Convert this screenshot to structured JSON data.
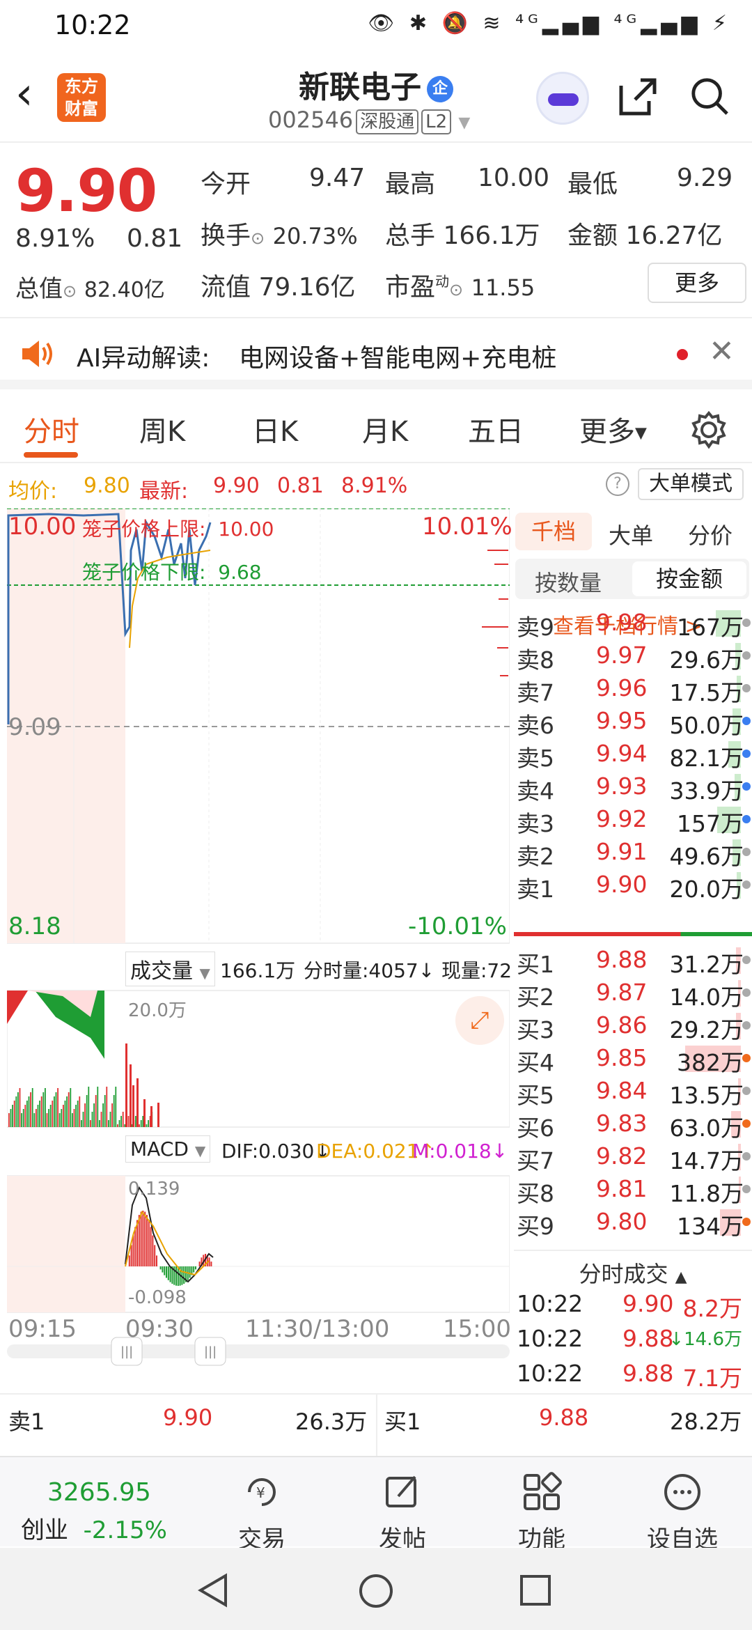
{
  "status": {
    "time": "10:22",
    "icons": "👁 ✱ 🔕 ≋ ⁴ᴳ▂▄▆ ⁴ᴳ▂▄▆ ⚡"
  },
  "header": {
    "title": "新联电子",
    "badge": "企",
    "code": "002546",
    "tag1": "深股通",
    "tag2": "L2",
    "logo_l1": "东方",
    "logo_l2": "财富"
  },
  "quote": {
    "price": "9.90",
    "pct": "8.91%",
    "chg": "0.81",
    "open_l": "今开",
    "open_v": "9.47",
    "high_l": "最高",
    "high_v": "10.00",
    "low_l": "最低",
    "low_v": "9.29",
    "turn_l": "换手",
    "turn_v": "20.73%",
    "vol_l": "总手",
    "vol_v": "166.1万",
    "amt_l": "金额",
    "amt_v": "16.27亿",
    "cap_l": "总值",
    "cap_v": "82.40亿",
    "flt_l": "流值",
    "flt_v": "79.16亿",
    "pe_l": "市盈",
    "pe_sup": "动",
    "pe_v": "11.55",
    "more": "更多"
  },
  "ai_banner": {
    "label": "AI异动解读:",
    "text": "电网设备+智能电网+充电桩"
  },
  "tabs": [
    "分时",
    "周K",
    "日K",
    "月K",
    "五日",
    "更多"
  ],
  "info": {
    "avg_l": "均价:",
    "avg_v": "9.80",
    "last_l": "最新:",
    "last_v": "9.90",
    "chg": "0.81",
    "pct": "8.91%",
    "mode": "大单模式"
  },
  "chart": {
    "top_price": "10.00",
    "top_pct": "10.01%",
    "mid_price": "9.09",
    "bot_price": "8.18",
    "bot_pct": "-10.01%",
    "cage_up_l": "笼子价格上限:",
    "cage_up_v": "10.00",
    "cage_dn_l": "笼子价格下限:",
    "cage_dn_v": "9.68",
    "vol_sel": "成交量",
    "vol_total": "166.1万",
    "vol_min_l": "分时量:4057↓",
    "vol_now": "现量:72",
    "vol_scale": "20.0万",
    "macd_sel": "MACD",
    "dif": "DIF:0.030↓",
    "dea": "DEA:0.021↑",
    "m": "M:0.018↓",
    "macd_top": "0.139",
    "macd_bot": "-0.098",
    "times": [
      "09:15",
      "09:30",
      "11:30/13:00",
      "15:00"
    ]
  },
  "orderbook": {
    "tabs": [
      "千档",
      "大单",
      "分价"
    ],
    "sub": [
      "按数量",
      "按金额"
    ],
    "link": "查看千档行情 >",
    "asks": [
      {
        "l": "卖9",
        "p": "9.98",
        "v": "167万",
        "bar": 36,
        "dot": "#aaa"
      },
      {
        "l": "卖8",
        "p": "9.97",
        "v": "29.6万",
        "bar": 8,
        "dot": "#aaa"
      },
      {
        "l": "卖7",
        "p": "9.96",
        "v": "17.5万",
        "bar": 6,
        "dot": "#aaa"
      },
      {
        "l": "卖6",
        "p": "9.95",
        "v": "50.0万",
        "bar": 12,
        "dot": "#3a7ef0"
      },
      {
        "l": "卖5",
        "p": "9.94",
        "v": "82.1万",
        "bar": 18,
        "dot": "#3a7ef0"
      },
      {
        "l": "卖4",
        "p": "9.93",
        "v": "33.9万",
        "bar": 9,
        "dot": "#3a7ef0"
      },
      {
        "l": "卖3",
        "p": "9.92",
        "v": "157万",
        "bar": 34,
        "dot": "#3a7ef0"
      },
      {
        "l": "卖2",
        "p": "9.91",
        "v": "49.6万",
        "bar": 12,
        "dot": "#aaa"
      },
      {
        "l": "卖1",
        "p": "9.90",
        "v": "20.0万",
        "bar": 6,
        "dot": "#aaa"
      }
    ],
    "bids": [
      {
        "l": "买1",
        "p": "9.88",
        "v": "31.2万",
        "bar": 7,
        "dot": "#aaa"
      },
      {
        "l": "买2",
        "p": "9.87",
        "v": "14.0万",
        "bar": 4,
        "dot": "#aaa"
      },
      {
        "l": "买3",
        "p": "9.86",
        "v": "29.2万",
        "bar": 7,
        "dot": "#aaa"
      },
      {
        "l": "买4",
        "p": "9.85",
        "v": "382万",
        "bar": 80,
        "dot": "#f06a1c"
      },
      {
        "l": "买5",
        "p": "9.84",
        "v": "13.5万",
        "bar": 4,
        "dot": "#aaa"
      },
      {
        "l": "买6",
        "p": "9.83",
        "v": "63.0万",
        "bar": 14,
        "dot": "#f06a1c"
      },
      {
        "l": "买7",
        "p": "9.82",
        "v": "14.7万",
        "bar": 4,
        "dot": "#aaa"
      },
      {
        "l": "买8",
        "p": "9.81",
        "v": "11.8万",
        "bar": 3,
        "dot": "#aaa"
      },
      {
        "l": "买9",
        "p": "9.80",
        "v": "134万",
        "bar": 30,
        "dot": "#f06a1c"
      }
    ],
    "trades_title": "分时成交",
    "trades": [
      {
        "t": "10:22",
        "p": "9.90",
        "v": "8.2万",
        "arrow": ""
      },
      {
        "t": "10:22",
        "p": "9.88",
        "v": "14.6万",
        "arrow": "↓"
      },
      {
        "t": "10:22",
        "p": "9.88",
        "v": "7.1万",
        "arrow": ""
      }
    ]
  },
  "bottom_quote": {
    "s1_l": "卖1",
    "s1_p": "9.90",
    "s1_v": "26.3万",
    "b1_l": "买1",
    "b1_p": "9.88",
    "b1_v": "28.2万"
  },
  "nav": {
    "index_v": "3265.95",
    "index_name": "创业",
    "index_pct": "-2.15%",
    "items": [
      "交易",
      "发帖",
      "功能",
      "设自选"
    ]
  }
}
